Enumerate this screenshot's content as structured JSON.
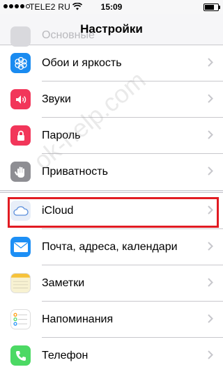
{
  "status_bar": {
    "carrier": "TELE2 RU",
    "time": "15:09",
    "signal_dots_filled": 4,
    "signal_dots_total": 5,
    "battery_level": 0.7
  },
  "nav": {
    "title": "Настройки",
    "partial_row_label": "Основные"
  },
  "group_a": [
    {
      "label": "Обои и яркость",
      "icon": "wallpaper-flower-icon",
      "color": "#1a8bf0"
    },
    {
      "label": "Звуки",
      "icon": "speaker-icon",
      "color": "#f2365a"
    },
    {
      "label": "Пароль",
      "icon": "lock-icon",
      "color": "#f2365a"
    },
    {
      "label": "Приватность",
      "icon": "hand-icon",
      "color": "#8e8e93"
    }
  ],
  "group_b": [
    {
      "label": "iCloud",
      "icon": "cloud-icon",
      "color": "#e8eef8"
    },
    {
      "label": "Почта, адреса, календари",
      "icon": "mail-icon",
      "color": "#1d8ff5"
    },
    {
      "label": "Заметки",
      "icon": "notes-icon",
      "color": "#f8f2d2"
    },
    {
      "label": "Напоминания",
      "icon": "reminders-icon",
      "color": "#ffffff"
    },
    {
      "label": "Телефон",
      "icon": "phone-icon",
      "color": "#4cd964"
    }
  ],
  "watermark": "ok-help.com",
  "colors": {
    "highlight": "#e11b22",
    "chevron": "#c7c7cc",
    "separator": "#c8c7cc",
    "background": "#efeff4"
  }
}
